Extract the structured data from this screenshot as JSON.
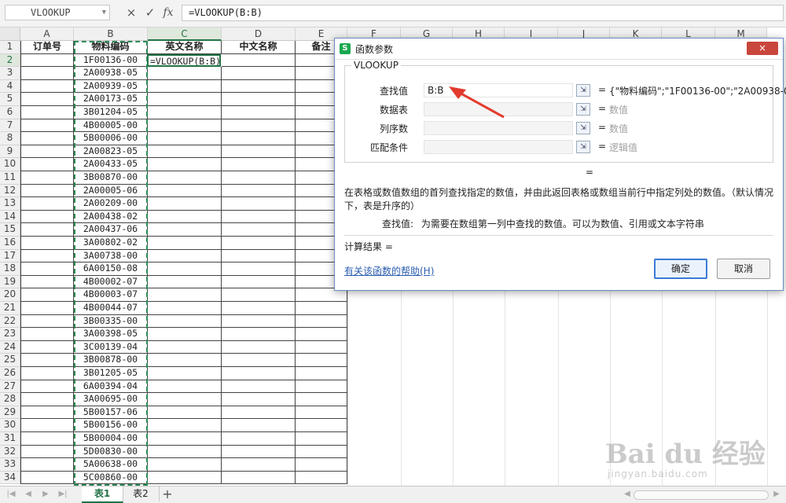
{
  "formula_bar": {
    "name_box": "VLOOKUP",
    "cancel_icon": "×",
    "accept_icon": "✓",
    "fx": "fx",
    "formula": "=VLOOKUP(B:B)"
  },
  "columns": [
    "A",
    "B",
    "C",
    "D",
    "E",
    "F",
    "G",
    "H",
    "I",
    "J",
    "K",
    "L",
    "M"
  ],
  "header_row": [
    "订单号",
    "物料编码",
    "英文名称",
    "中文名称",
    "备注"
  ],
  "rows": [
    "1",
    "2",
    "3",
    "4",
    "5",
    "6",
    "7",
    "8",
    "9",
    "10",
    "11",
    "12",
    "13",
    "14",
    "15",
    "16",
    "17",
    "18",
    "19",
    "20",
    "21",
    "22",
    "23",
    "24",
    "25",
    "26",
    "27",
    "28",
    "29",
    "30",
    "31",
    "32",
    "33",
    "34"
  ],
  "material_codes": [
    "1F00136-00",
    "2A00938-05",
    "2A00939-05",
    "2A00173-05",
    "3B01204-05",
    "4B00005-00",
    "5B00006-00",
    "2A00823-05",
    "2A00433-05",
    "3B00870-00",
    "2A00005-06",
    "2A00209-00",
    "2A00438-02",
    "2A00437-06",
    "3A00802-02",
    "3A00738-00",
    "6A00150-08",
    "4B00002-07",
    "4B00003-07",
    "4B00044-07",
    "3B00335-00",
    "3A00398-05",
    "3C00139-04",
    "3B00878-00",
    "3B01205-05",
    "6A00394-04",
    "3A00695-00",
    "5B00157-06",
    "5B00156-00",
    "5B00004-00",
    "5D00830-00",
    "5A00638-00",
    "5C00860-00"
  ],
  "active_cell_text": "=VLOOKUP(B:B)",
  "sheet_tabs": {
    "tab1": "表1",
    "tab2": "表2",
    "add": "+"
  },
  "dialog": {
    "title": "函数参数",
    "close": "×",
    "function_name": "VLOOKUP",
    "args": [
      {
        "label": "查找值",
        "value": "B:B",
        "result": "{\"物料编码\";\"1F00136-00\";\"2A00938-05...",
        "gray": false
      },
      {
        "label": "数据表",
        "value": "",
        "result": "数值",
        "gray": true
      },
      {
        "label": "列序数",
        "value": "",
        "result": "数值",
        "gray": true
      },
      {
        "label": "匹配条件",
        "value": "",
        "result": "逻辑值",
        "gray": true
      }
    ],
    "equals": "=",
    "result_eq": "=",
    "description": "在表格或数值数组的首列查找指定的数值，并由此返回表格或数组当前行中指定列处的数值。（默认情况下，表是升序的）",
    "arg_help_label": "查找值:",
    "arg_help_text": "为需要在数组第一列中查找的数值。可以为数值、引用或文本字符串",
    "calc_result": "计算结果 =",
    "help_link": "有关该函数的帮助(H)",
    "ok": "确定",
    "cancel": "取消"
  },
  "watermark": {
    "logo": "Bai du 经验",
    "url": "jingyan.baidu.com"
  }
}
